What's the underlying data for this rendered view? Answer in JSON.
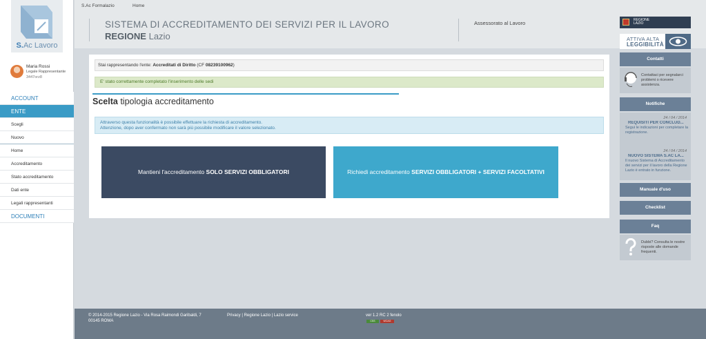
{
  "app": {
    "logo_text_bold": "S.",
    "logo_text": "Ac Lavoro"
  },
  "topbar": {
    "crumb1": "S.Ac Formalazio",
    "crumb2": "Home"
  },
  "header": {
    "title_line1": "SISTEMA DI ACCREDITAMENTO DEI SERVIZI PER IL LAVORO",
    "title_bold": "REGIONE",
    "title_rest": "Lazio",
    "assessorato": "Assessorato al Lavoro"
  },
  "user": {
    "name": "Maria Rossi",
    "role": "Legale Rappresentante",
    "code": "3447orz8"
  },
  "nav": {
    "account": "ACCOUNT",
    "ente": "ENTE",
    "scegli": "Scegli",
    "nuovo": "Nuovo",
    "home": "Home",
    "accreditamento": "Accreditamento",
    "stato": "Stato accreditamento",
    "dati": "Dati ente",
    "legali": "Legali rappresentanti",
    "documenti": "DOCUMENTI"
  },
  "main": {
    "ente_prefix": "Stai rappresentando l'ente:",
    "ente_name": "Accreditati di Diritto",
    "ente_cf_prefix": "(CF",
    "ente_cf": "08239100962",
    "ente_cf_suffix": ")",
    "success_msg": "E' stato correttamente completato l'inserimento delle sedi",
    "section_bold": "Scelta",
    "section_rest": "tipologia accreditamento",
    "info_line1": "Attraverso questa funzionalità è possibile effettuare la richiesta di accreditamento.",
    "info_line2": "Attenzione, dopo aver confermato non sarà più possibile modificare il valore selezionato.",
    "btn_left_prefix": "Mantieni l'accreditamento",
    "btn_left_bold": "SOLO SERVIZI OBBLIGATORI",
    "btn_right_prefix": "Richiedi accreditamento",
    "btn_right_bold": "SERVIZI OBBLIGATORI + SERVIZI FACOLTATIVI"
  },
  "right": {
    "regione_l1": "REGIONE",
    "regione_l2": "LAZIO",
    "legg_l1": "ATTIVA ALTA",
    "legg_l2": "LEGGIBILITÀ",
    "contatti": "Contatti",
    "contatti_text": "Contattaci per segnalarci problemi o ricevere assistenza.",
    "notifiche": "Notifiche",
    "notif1_date": "24 / 04 / 2014",
    "notif1_title": "REQUISITI PER CONCLUD...",
    "notif1_body": "Segui le indicazioni per completare la registrazione.",
    "notif2_date": "24 / 04 / 2014",
    "notif2_title": "NUOVO SISTEMA S.AC LA...",
    "notif2_body": "Il nuovo Sistema di Accreditamento dei servizi per il lavoro della Regione Lazio è entrato in funzione.",
    "manuale": "Manuale d'uso",
    "checklist": "Checklist",
    "faq": "Faq",
    "faq_text": "Dubbi? Consulta le nostre risposte alle domande frequenti."
  },
  "footer": {
    "copyright_l1": "© 2014-2015 Regione Lazio - Via Rosa Raimondi Garibaldi, 7",
    "copyright_l2": "00145 ROMA",
    "links": "Privacy | Regione Lazio | Lazio service",
    "version": "ver 1.2 RC 2 fenolo",
    "badge1": "CSS",
    "badge2": "WCAG"
  },
  "colors": {
    "accent": "#3a9bc6",
    "dark_button": "#3b4a62",
    "light_button": "#3ea8cc",
    "side_button": "#6b8097",
    "footer": "#6d7b89"
  }
}
